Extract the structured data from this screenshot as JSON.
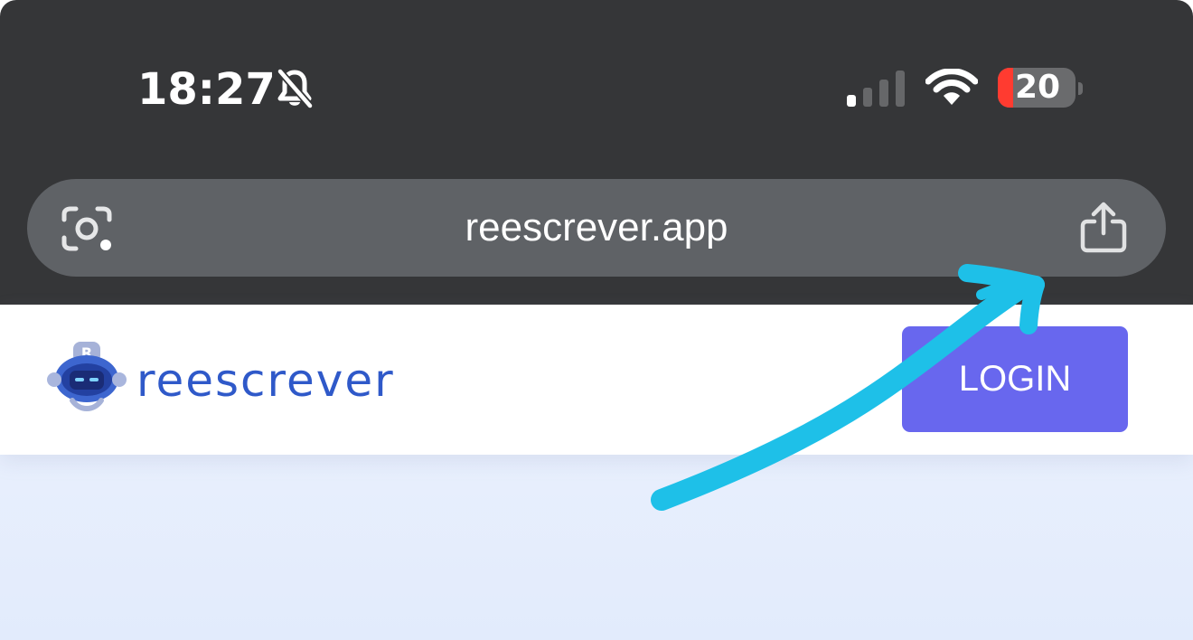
{
  "status_bar": {
    "time": "18:27",
    "bell_icon": "bell-slash-icon",
    "signal_icon": "cellular-signal-icon",
    "wifi_icon": "wifi-icon",
    "battery_percent": "20",
    "battery_level": 0.2,
    "battery_low_color": "#ff3b30"
  },
  "browser": {
    "url": "reescrever.app",
    "lens_icon": "camera-lens-icon",
    "share_icon": "share-icon",
    "chrome_color": "#353638",
    "url_bar_color": "#5f6266"
  },
  "site": {
    "logo_text": "reescrever",
    "logo_icon": "robot-logo-icon",
    "login_button": "LOGIN",
    "brand_color": "#2f59c9",
    "button_color": "#6867ee",
    "hero_background": "#e8effd"
  },
  "annotation": {
    "arrow_color": "#1ec0e8"
  }
}
